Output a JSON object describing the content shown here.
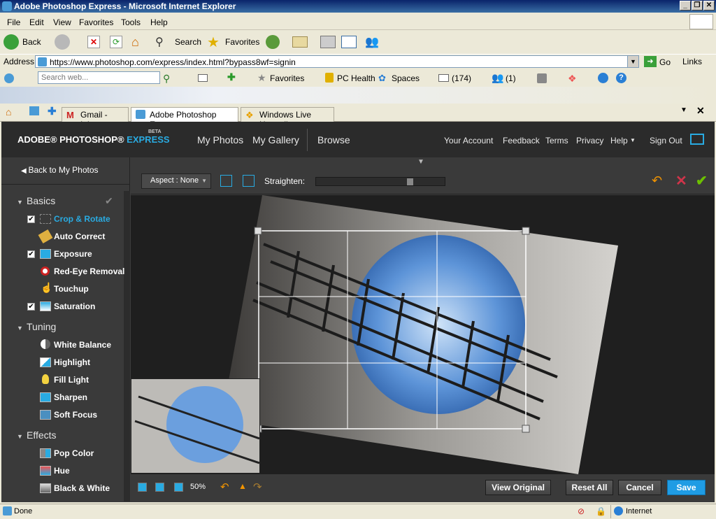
{
  "window": {
    "title": "Adobe Photoshop Express - Microsoft Internet Explorer"
  },
  "menu": [
    "File",
    "Edit",
    "View",
    "Favorites",
    "Tools",
    "Help"
  ],
  "toolbar": {
    "back": "Back",
    "search": "Search",
    "favorites": "Favorites"
  },
  "address": {
    "label": "Address",
    "url": "https://www.photoshop.com/express/index.html?bypass8wf=signin",
    "go": "Go",
    "links": "Links"
  },
  "linksbar": {
    "search_placeholder": "Search web...",
    "favorites": "Favorites",
    "pc_health": "PC Health",
    "spaces": "Spaces",
    "mail_count": "(174)",
    "messenger_count": "(1)"
  },
  "tabs": [
    {
      "label": "Gmail - Inbox"
    },
    {
      "label": "Adobe Photoshop Expr..."
    },
    {
      "label": "Windows Live Hotmail"
    }
  ],
  "app": {
    "logo_main": "ADOBE® PHOTOSHOP® ",
    "logo_accent": "EXPRESS",
    "logo_badge": "BETA",
    "nav": [
      "My Photos",
      "My Gallery",
      "Browse"
    ],
    "top_links": [
      "Your Account",
      "Feedback",
      "Terms",
      "Privacy",
      "Help",
      "Sign Out"
    ],
    "back_label": "Back to My Photos",
    "sections": {
      "basics": "Basics",
      "tuning": "Tuning",
      "effects": "Effects"
    },
    "basics": [
      "Crop & Rotate",
      "Auto Correct",
      "Exposure",
      "Red-Eye Removal",
      "Touchup",
      "Saturation"
    ],
    "tuning": [
      "White Balance",
      "Highlight",
      "Fill Light",
      "Sharpen",
      "Soft Focus"
    ],
    "effects": [
      "Pop Color",
      "Hue",
      "Black & White"
    ],
    "aspect": "Aspect : None",
    "straighten": "Straighten:",
    "straighten_level": 0.74,
    "zoom": "50%",
    "buttons": {
      "view_original": "View Original",
      "reset_all": "Reset All",
      "cancel": "Cancel",
      "save": "Save"
    }
  },
  "status": {
    "text": "Done",
    "zone": "Internet"
  },
  "colors": {
    "accent": "#29abe2",
    "save": "#1f9ce4",
    "title": "#0a246a"
  }
}
